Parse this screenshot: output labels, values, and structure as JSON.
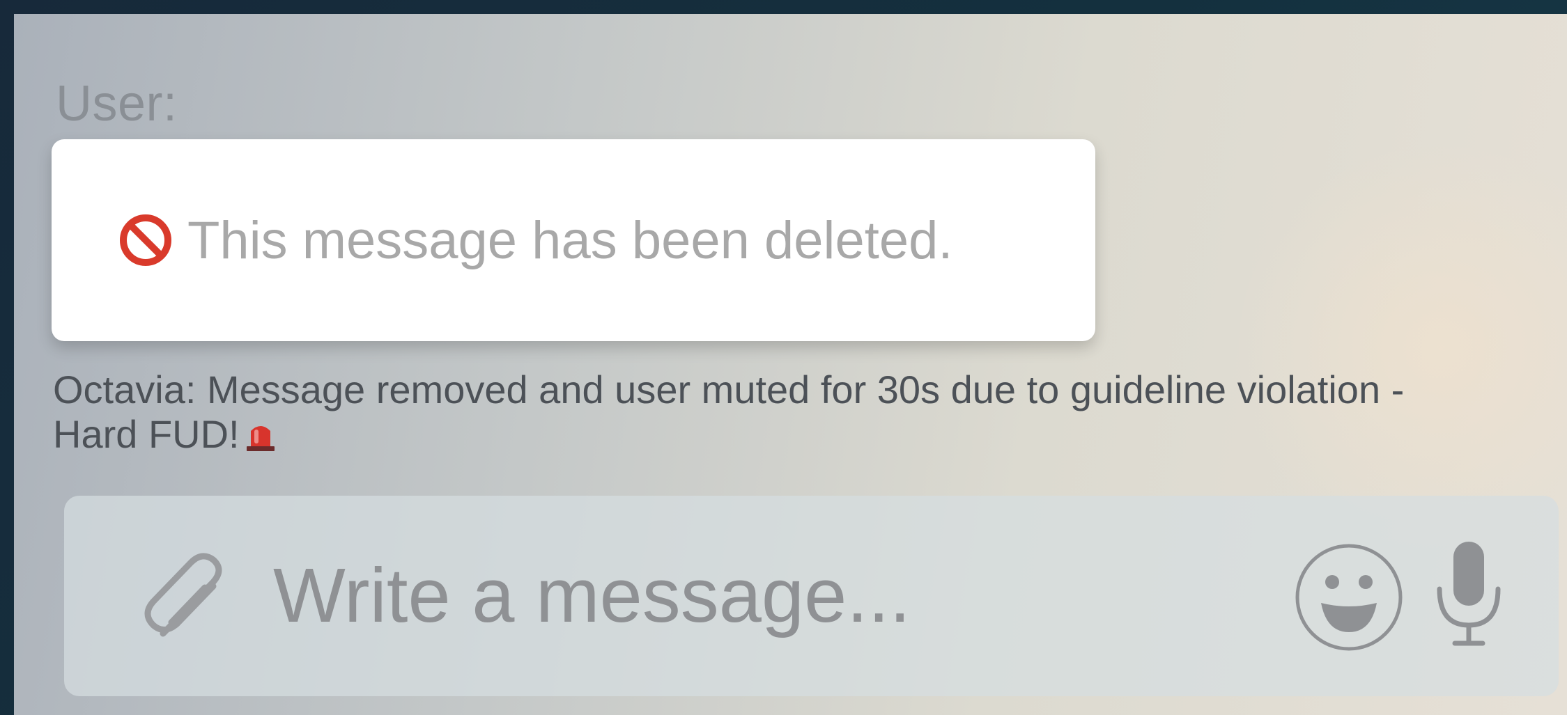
{
  "chat": {
    "sender_label": "User:",
    "deleted_notice": "This message has been deleted.",
    "deleted_icon": "prohibited-icon",
    "bot_message": "Octavia: Message removed and user muted for 30s due to guideline violation - Hard FUD!",
    "bot_message_icon": "police-siren-icon"
  },
  "composer": {
    "placeholder": "Write a message...",
    "attach_icon": "paperclip-icon",
    "emoji_icon": "smiley-icon",
    "mic_icon": "microphone-icon"
  },
  "colors": {
    "prohibit_red": "#d93a2b",
    "siren_red": "#d8342c",
    "muted_text": "#a8a8a8",
    "icon_gray": "#8f9194"
  }
}
